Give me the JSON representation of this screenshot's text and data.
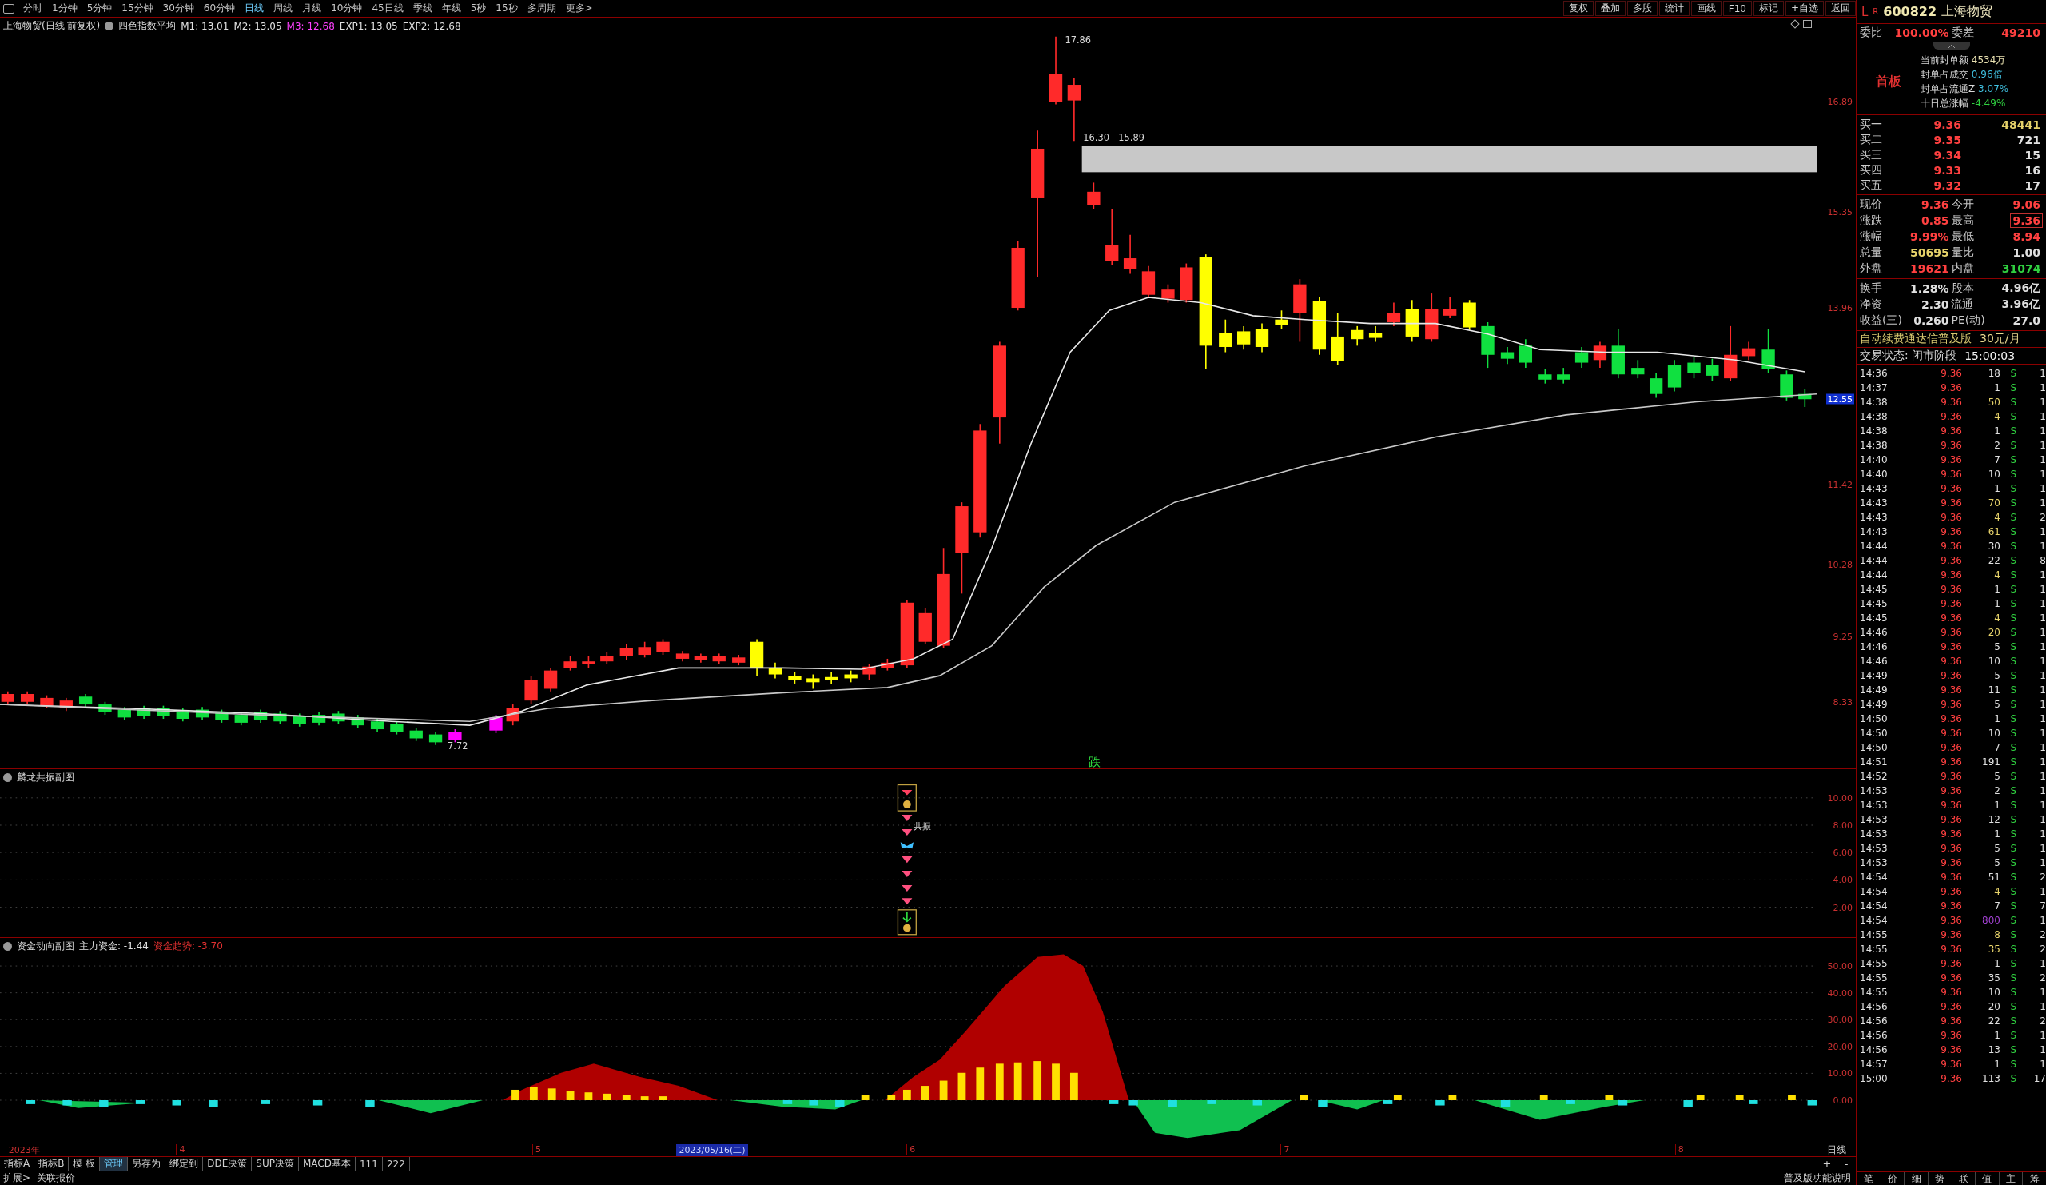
{
  "toolbar": {
    "periods": [
      {
        "label": "分时",
        "selected": false
      },
      {
        "label": "1分钟",
        "selected": false
      },
      {
        "label": "5分钟",
        "selected": false
      },
      {
        "label": "15分钟",
        "selected": false
      },
      {
        "label": "30分钟",
        "selected": false
      },
      {
        "label": "60分钟",
        "selected": false
      },
      {
        "label": "日线",
        "selected": true
      },
      {
        "label": "周线",
        "selected": false
      },
      {
        "label": "月线",
        "selected": false
      },
      {
        "label": "10分钟",
        "selected": false
      },
      {
        "label": "45日线",
        "selected": false
      },
      {
        "label": "季线",
        "selected": false
      },
      {
        "label": "年线",
        "selected": false
      },
      {
        "label": "5秒",
        "selected": false
      },
      {
        "label": "15秒",
        "selected": false
      },
      {
        "label": "多周期",
        "selected": false
      }
    ],
    "more": "更多>",
    "actions": [
      "复权",
      "叠加",
      "多股",
      "统计",
      "画线",
      "F10",
      "标记",
      "+自选",
      "返回"
    ]
  },
  "chart_header": {
    "title": "上海物贸(日线 前复权)",
    "indicator": "四色指数平均",
    "values": [
      {
        "label": "M1: 13.01",
        "color": "#e0e0e0"
      },
      {
        "label": "M2: 13.05",
        "color": "#e0e0e0"
      },
      {
        "label": "M3: 12.68",
        "color": "#ff40ff"
      },
      {
        "label": "EXP1: 13.05",
        "color": "#e0e0e0"
      },
      {
        "label": "EXP2: 12.68",
        "color": "#e0e0e0"
      }
    ]
  },
  "main_chart": {
    "y_labels": [
      {
        "label": "16.89",
        "kind": "tick"
      },
      {
        "label": "15.35",
        "kind": "tick"
      },
      {
        "label": "13.96",
        "kind": "tick"
      },
      {
        "label": "12.55",
        "kind": "current"
      },
      {
        "label": "11.42",
        "kind": "tick"
      },
      {
        "label": "10.28",
        "kind": "tick"
      },
      {
        "label": "9.25",
        "kind": "tick"
      },
      {
        "label": "8.33",
        "kind": "tick"
      }
    ],
    "high_label": "17.86",
    "gap_label": "16.30 - 15.89",
    "low_label": "7.72",
    "signal": "跌"
  },
  "sub_chart_1": {
    "title": "麟龙共振副图",
    "signal": "共振",
    "y_labels": [
      "10.00",
      "8.00",
      "6.00",
      "4.00",
      "2.00"
    ]
  },
  "sub_chart_2": {
    "title": "资金动向副图",
    "values": [
      {
        "label": "主力资金: -1.44",
        "color": "#e0e0e0"
      },
      {
        "label": "资金趋势: -3.70",
        "color": "#e03030"
      }
    ],
    "y_labels": [
      "50.00",
      "40.00",
      "30.00",
      "20.00",
      "10.00",
      "0.00"
    ]
  },
  "date_axis": {
    "labels": [
      {
        "label": "2023年",
        "selected": false
      },
      {
        "label": "4",
        "selected": false
      },
      {
        "label": "5",
        "selected": false
      },
      {
        "label": "2023/05/16(二)",
        "selected": true
      },
      {
        "label": "6",
        "selected": false
      },
      {
        "label": "7",
        "selected": false
      },
      {
        "label": "8",
        "selected": false
      }
    ],
    "period": "日线"
  },
  "bottom_tabs": [
    {
      "label": "指标A",
      "selected": false
    },
    {
      "label": "指标B",
      "selected": false
    },
    {
      "label": "模 板",
      "selected": false
    },
    {
      "label": "管理",
      "selected": true
    },
    {
      "label": "另存为",
      "selected": false
    },
    {
      "label": "绑定到",
      "selected": false
    },
    {
      "label": "DDE决策",
      "selected": false
    },
    {
      "label": "SUP决策",
      "selected": false
    },
    {
      "label": "MACD基本",
      "selected": false
    },
    {
      "label": "111",
      "selected": false
    },
    {
      "label": "222",
      "selected": false
    }
  ],
  "zoom_buttons": [
    "+",
    "-"
  ],
  "status_bar": {
    "items": [
      "扩展>",
      "关联报价"
    ],
    "help": "普及版功能说明"
  },
  "side_panel": {
    "market": "L",
    "flag": "R",
    "code": "600822",
    "name": "上海物贸",
    "ratio": {
      "label": "委比",
      "value": "100.00%",
      "diff_label": "委差",
      "diff_value": "49210"
    },
    "board": "首板",
    "stats": [
      {
        "label": "当前封单额",
        "value": "4534万",
        "color": "#e8e0b0"
      },
      {
        "label": "封单占成交",
        "value": "0.96倍",
        "color": "#40c0e0"
      },
      {
        "label": "封单占流通Z",
        "value": "3.07%",
        "color": "#40c0e0"
      },
      {
        "label": "十日总涨幅",
        "value": "-4.49%",
        "color": "#30d040"
      }
    ],
    "bids": [
      {
        "label": "买一",
        "price": "9.36",
        "volume": "48441"
      },
      {
        "label": "买二",
        "price": "9.35",
        "volume": "721"
      },
      {
        "label": "买三",
        "price": "9.34",
        "volume": "15"
      },
      {
        "label": "买四",
        "price": "9.33",
        "volume": "16"
      },
      {
        "label": "买五",
        "price": "9.32",
        "volume": "17"
      }
    ],
    "quote": [
      {
        "label": "现价",
        "value": "9.36",
        "color": "#ff4040",
        "boxed": false
      },
      {
        "label": "今开",
        "value": "9.06",
        "color": "#ff4040",
        "boxed": false
      },
      {
        "label": "涨跌",
        "value": "0.85",
        "color": "#ff4040",
        "boxed": false
      },
      {
        "label": "最高",
        "value": "9.36",
        "color": "#ff4040",
        "boxed": true
      },
      {
        "label": "涨幅",
        "value": "9.99%",
        "color": "#ff4040",
        "boxed": false
      },
      {
        "label": "最低",
        "value": "8.94",
        "color": "#ff4040",
        "boxed": false
      },
      {
        "label": "总量",
        "value": "50695",
        "color": "#e6d26a",
        "boxed": false
      },
      {
        "label": "量比",
        "value": "1.00",
        "color": "#e0e0e0",
        "boxed": false
      },
      {
        "label": "外盘",
        "value": "19621",
        "color": "#ff4040",
        "boxed": false
      },
      {
        "label": "内盘",
        "value": "31074",
        "color": "#30d040",
        "boxed": false
      },
      {
        "label": "换手",
        "value": "1.28%",
        "color": "#e0e0e0",
        "boxed": false
      },
      {
        "label": "股本",
        "value": "4.96亿",
        "color": "#e0e0e0",
        "boxed": false
      },
      {
        "label": "净资",
        "value": "2.30",
        "color": "#e0e0e0",
        "boxed": false
      },
      {
        "label": "流通",
        "value": "3.96亿",
        "color": "#e0e0e0",
        "boxed": false
      },
      {
        "label": "收益(三)",
        "value": "0.260",
        "color": "#e0e0e0",
        "boxed": false
      },
      {
        "label": "PE(动)",
        "value": "27.0",
        "color": "#e0e0e0",
        "boxed": false
      }
    ],
    "promo": "自动续费通达信普及版",
    "promo_price": "30元/月",
    "status": "交易状态: 闭市阶段",
    "status_time": "15:00:03",
    "trades": [
      {
        "time": "14:36",
        "price": "9.36",
        "volume": "18",
        "color": "#e0e0e0",
        "side": "S",
        "count": "1"
      },
      {
        "time": "14:37",
        "price": "9.36",
        "volume": "1",
        "color": "#e0e0e0",
        "side": "S",
        "count": "1"
      },
      {
        "time": "14:38",
        "price": "9.36",
        "volume": "50",
        "color": "#e6d26a",
        "side": "S",
        "count": "1"
      },
      {
        "time": "14:38",
        "price": "9.36",
        "volume": "4",
        "color": "#e6d26a",
        "side": "S",
        "count": "1"
      },
      {
        "time": "14:38",
        "price": "9.36",
        "volume": "1",
        "color": "#e0e0e0",
        "side": "S",
        "count": "1"
      },
      {
        "time": "14:38",
        "price": "9.36",
        "volume": "2",
        "color": "#e0e0e0",
        "side": "S",
        "count": "1"
      },
      {
        "time": "14:40",
        "price": "9.36",
        "volume": "7",
        "color": "#e0e0e0",
        "side": "S",
        "count": "1"
      },
      {
        "time": "14:40",
        "price": "9.36",
        "volume": "10",
        "color": "#e0e0e0",
        "side": "S",
        "count": "1"
      },
      {
        "time": "14:43",
        "price": "9.36",
        "volume": "1",
        "color": "#e0e0e0",
        "side": "S",
        "count": "1"
      },
      {
        "time": "14:43",
        "price": "9.36",
        "volume": "70",
        "color": "#e6d26a",
        "side": "S",
        "count": "1"
      },
      {
        "time": "14:43",
        "price": "9.36",
        "volume": "4",
        "color": "#e6d26a",
        "side": "S",
        "count": "2"
      },
      {
        "time": "14:43",
        "price": "9.36",
        "volume": "61",
        "color": "#e6d26a",
        "side": "S",
        "count": "1"
      },
      {
        "time": "14:44",
        "price": "9.36",
        "volume": "30",
        "color": "#e0e0e0",
        "side": "S",
        "count": "1"
      },
      {
        "time": "14:44",
        "price": "9.36",
        "volume": "22",
        "color": "#e0e0e0",
        "side": "S",
        "count": "8"
      },
      {
        "time": "14:44",
        "price": "9.36",
        "volume": "4",
        "color": "#e6d26a",
        "side": "S",
        "count": "1"
      },
      {
        "time": "14:45",
        "price": "9.36",
        "volume": "1",
        "color": "#e0e0e0",
        "side": "S",
        "count": "1"
      },
      {
        "time": "14:45",
        "price": "9.36",
        "volume": "1",
        "color": "#e0e0e0",
        "side": "S",
        "count": "1"
      },
      {
        "time": "14:45",
        "price": "9.36",
        "volume": "4",
        "color": "#e6d26a",
        "side": "S",
        "count": "1"
      },
      {
        "time": "14:46",
        "price": "9.36",
        "volume": "20",
        "color": "#e6d26a",
        "side": "S",
        "count": "1"
      },
      {
        "time": "14:46",
        "price": "9.36",
        "volume": "5",
        "color": "#e0e0e0",
        "side": "S",
        "count": "1"
      },
      {
        "time": "14:46",
        "price": "9.36",
        "volume": "10",
        "color": "#e0e0e0",
        "side": "S",
        "count": "1"
      },
      {
        "time": "14:49",
        "price": "9.36",
        "volume": "5",
        "color": "#e0e0e0",
        "side": "S",
        "count": "1"
      },
      {
        "time": "14:49",
        "price": "9.36",
        "volume": "11",
        "color": "#e0e0e0",
        "side": "S",
        "count": "1"
      },
      {
        "time": "14:49",
        "price": "9.36",
        "volume": "5",
        "color": "#e0e0e0",
        "side": "S",
        "count": "1"
      },
      {
        "time": "14:50",
        "price": "9.36",
        "volume": "1",
        "color": "#e0e0e0",
        "side": "S",
        "count": "1"
      },
      {
        "time": "14:50",
        "price": "9.36",
        "volume": "10",
        "color": "#e0e0e0",
        "side": "S",
        "count": "1"
      },
      {
        "time": "14:50",
        "price": "9.36",
        "volume": "7",
        "color": "#e0e0e0",
        "side": "S",
        "count": "1"
      },
      {
        "time": "14:51",
        "price": "9.36",
        "volume": "191",
        "color": "#e0e0e0",
        "side": "S",
        "count": "1"
      },
      {
        "time": "14:52",
        "price": "9.36",
        "volume": "5",
        "color": "#e0e0e0",
        "side": "S",
        "count": "1"
      },
      {
        "time": "14:53",
        "price": "9.36",
        "volume": "2",
        "color": "#e0e0e0",
        "side": "S",
        "count": "1"
      },
      {
        "time": "14:53",
        "price": "9.36",
        "volume": "1",
        "color": "#e0e0e0",
        "side": "S",
        "count": "1"
      },
      {
        "time": "14:53",
        "price": "9.36",
        "volume": "12",
        "color": "#e0e0e0",
        "side": "S",
        "count": "1"
      },
      {
        "time": "14:53",
        "price": "9.36",
        "volume": "1",
        "color": "#e0e0e0",
        "side": "S",
        "count": "1"
      },
      {
        "time": "14:53",
        "price": "9.36",
        "volume": "5",
        "color": "#e0e0e0",
        "side": "S",
        "count": "1"
      },
      {
        "time": "14:53",
        "price": "9.36",
        "volume": "5",
        "color": "#e0e0e0",
        "side": "S",
        "count": "1"
      },
      {
        "time": "14:54",
        "price": "9.36",
        "volume": "51",
        "color": "#e0e0e0",
        "side": "S",
        "count": "2"
      },
      {
        "time": "14:54",
        "price": "9.36",
        "volume": "4",
        "color": "#e6d26a",
        "side": "S",
        "count": "1"
      },
      {
        "time": "14:54",
        "price": "9.36",
        "volume": "7",
        "color": "#e0e0e0",
        "side": "S",
        "count": "7"
      },
      {
        "time": "14:54",
        "price": "9.36",
        "volume": "800",
        "color": "#a040d0",
        "side": "S",
        "count": "1"
      },
      {
        "time": "14:55",
        "price": "9.36",
        "volume": "8",
        "color": "#e6d26a",
        "side": "S",
        "count": "2"
      },
      {
        "time": "14:55",
        "price": "9.36",
        "volume": "35",
        "color": "#e6d26a",
        "side": "S",
        "count": "2"
      },
      {
        "time": "14:55",
        "price": "9.36",
        "volume": "1",
        "color": "#e0e0e0",
        "side": "S",
        "count": "1"
      },
      {
        "time": "14:55",
        "price": "9.36",
        "volume": "35",
        "color": "#e0e0e0",
        "side": "S",
        "count": "2"
      },
      {
        "time": "14:55",
        "price": "9.36",
        "volume": "10",
        "color": "#e0e0e0",
        "side": "S",
        "count": "1"
      },
      {
        "time": "14:56",
        "price": "9.36",
        "volume": "20",
        "color": "#e0e0e0",
        "side": "S",
        "count": "1"
      },
      {
        "time": "14:56",
        "price": "9.36",
        "volume": "22",
        "color": "#e0e0e0",
        "side": "S",
        "count": "2"
      },
      {
        "time": "14:56",
        "price": "9.36",
        "volume": "1",
        "color": "#e0e0e0",
        "side": "S",
        "count": "1"
      },
      {
        "time": "14:56",
        "price": "9.36",
        "volume": "13",
        "color": "#e0e0e0",
        "side": "S",
        "count": "1"
      },
      {
        "time": "14:57",
        "price": "9.36",
        "volume": "1",
        "color": "#e0e0e0",
        "side": "S",
        "count": "1"
      },
      {
        "time": "15:00",
        "price": "9.36",
        "volume": "113",
        "color": "#e0e0e0",
        "side": "S",
        "count": "17"
      }
    ],
    "tabs": [
      "笔",
      "价",
      "细",
      "势",
      "联",
      "值",
      "主",
      "筹"
    ]
  }
}
